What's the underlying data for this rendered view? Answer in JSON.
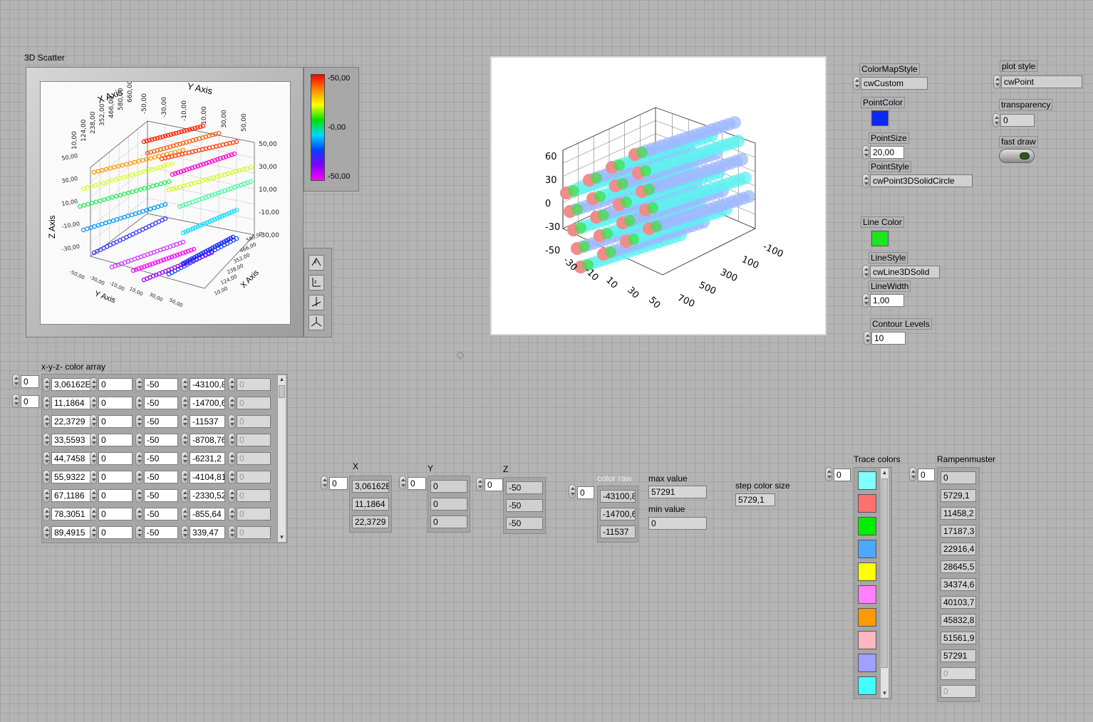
{
  "scatter3d": {
    "title": "3D Scatter",
    "x_axis_title": "X Axis",
    "y_axis_title": "Y Axis",
    "z_axis_title": "Z Axis",
    "x_ticks": [
      "10,00",
      "124,00",
      "238,00",
      "352,00",
      "466,00",
      "580,00",
      "660,00"
    ],
    "y_ticks": [
      "-50,00",
      "-30,00",
      "-10,00",
      "10,00",
      "30,00",
      "50,00"
    ],
    "z_ticks": [
      "50,00",
      "30,00",
      "10,00",
      "-10,00",
      "-30,00"
    ],
    "colorbar_labels": [
      "-50,00",
      "-0,00",
      "-50,00"
    ]
  },
  "graph3d": {
    "z_ticks": [
      "60",
      "30",
      "0",
      "-30",
      "-50"
    ],
    "y_ticks": [
      "-30",
      "-10",
      "10",
      "30",
      "50"
    ],
    "x_ticks": [
      "-100",
      "100",
      "300",
      "500",
      "700"
    ]
  },
  "controls": {
    "colormap_style": {
      "label": "ColorMapStyle",
      "value": "cwCustom"
    },
    "point_color": {
      "label": "PointColor",
      "color": "#0a28f0"
    },
    "point_size": {
      "label": "PointSize",
      "value": "20,00"
    },
    "point_style": {
      "label": "PointStyle",
      "value": "cwPoint3DSolidCircle"
    },
    "line_color": {
      "label": "Line Color",
      "color": "#1ee61e"
    },
    "line_style": {
      "label": "LineStyle",
      "value": "cwLine3DSolid"
    },
    "line_width": {
      "label": "LineWidth",
      "value": "1,00"
    },
    "contour_levels": {
      "label": "Contour Levels",
      "value": "10"
    },
    "plot_style": {
      "label": "plot style",
      "value": "cwPoint"
    },
    "transparency": {
      "label": "transparency",
      "value": "0"
    },
    "fast_draw": {
      "label": "fast draw"
    }
  },
  "xyz_array": {
    "label": "x-y-z- color array",
    "index0": "0",
    "index1": "0",
    "rows": [
      [
        "3,06162E",
        "0",
        "-50",
        "-43100,8",
        "0"
      ],
      [
        "11,1864",
        "0",
        "-50",
        "-14700,6",
        "0"
      ],
      [
        "22,3729",
        "0",
        "-50",
        "-11537",
        "0"
      ],
      [
        "33,5593",
        "0",
        "-50",
        "-8708,76",
        "0"
      ],
      [
        "44,7458",
        "0",
        "-50",
        "-6231,2",
        "0"
      ],
      [
        "55,9322",
        "0",
        "-50",
        "-4104,81",
        "0"
      ],
      [
        "67,1186",
        "0",
        "-50",
        "-2330,52",
        "0"
      ],
      [
        "78,3051",
        "0",
        "-50",
        "-855,64",
        "0"
      ],
      [
        "89,4915",
        "0",
        "-50",
        "339,47",
        "0"
      ]
    ]
  },
  "x_array": {
    "label": "X",
    "index": "0",
    "values": [
      "3,06162E",
      "11,1864",
      "22,3729"
    ]
  },
  "y_array": {
    "label": "Y",
    "index": "0",
    "values": [
      "0",
      "0",
      "0"
    ]
  },
  "z_array": {
    "label": "Z",
    "index": "0",
    "values": [
      "-50",
      "-50",
      "-50"
    ]
  },
  "color_raw": {
    "label": "color raw",
    "index": "0",
    "values": [
      "-43100,8",
      "-14700,6",
      "-11537"
    ]
  },
  "max_value": {
    "label": "max value",
    "value": "57291"
  },
  "min_value": {
    "label": "min value",
    "value": "0"
  },
  "step_color_size": {
    "label": "step color size",
    "value": "5729,1"
  },
  "trace_colors": {
    "label": "Trace colors",
    "index": "0",
    "colors": [
      "#80ffff",
      "#ff7070",
      "#00ee00",
      "#4ea8ff",
      "#ffff00",
      "#ff80ff",
      "#ff9900",
      "#ffb6c1",
      "#a0a0ff",
      "#40ffff"
    ]
  },
  "rampenmuster": {
    "label": "Rampenmuster",
    "index": "0",
    "values": [
      "0",
      "5729,1",
      "11458,2",
      "17187,3",
      "22916,4",
      "28645,5",
      "34374,6",
      "40103,7",
      "45832,8",
      "51561,9",
      "57291"
    ],
    "empty_values": [
      "0",
      "0"
    ]
  }
}
